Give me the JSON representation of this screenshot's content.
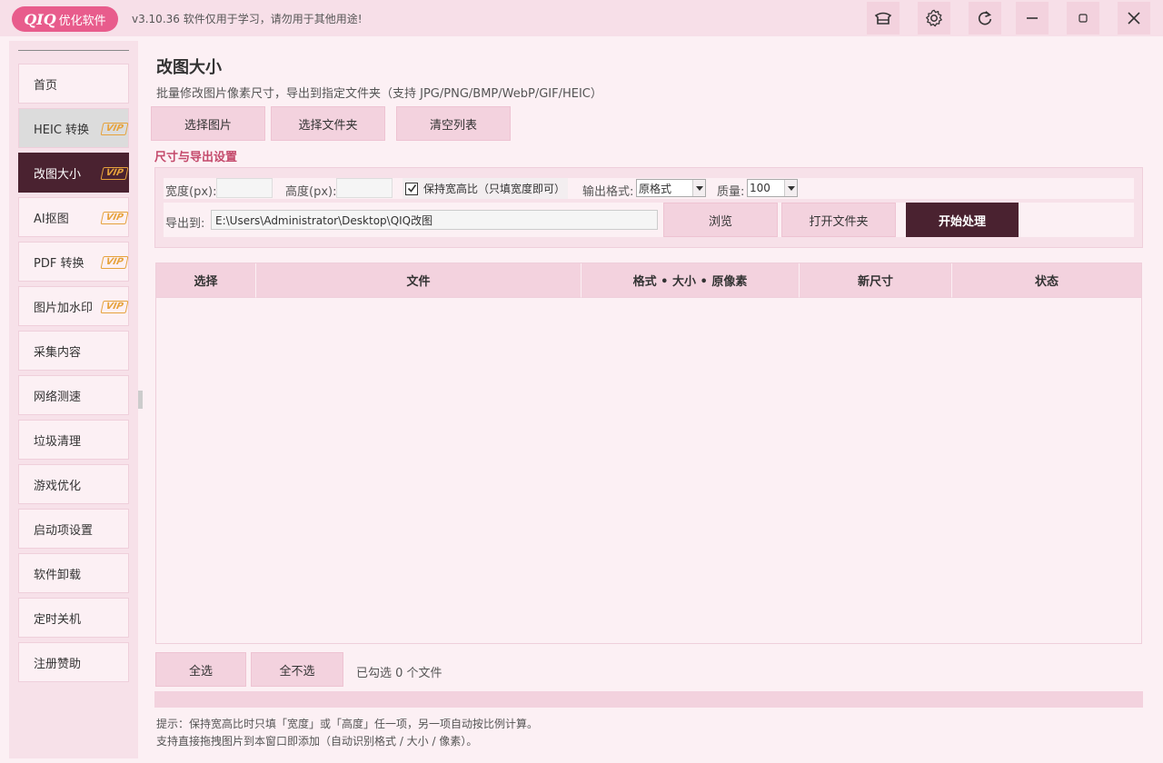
{
  "titlebar": {
    "logo_brand": "QIQ",
    "logo_text": "优化软件",
    "version": "v3.10.36 软件仅用于学习，请勿用于其他用途!",
    "icons": [
      "hat-icon",
      "gear-icon",
      "refresh-icon",
      "minimize-icon",
      "maximize-icon",
      "close-icon"
    ]
  },
  "sidebar": {
    "items": [
      {
        "label": "首页"
      },
      {
        "label": "HEIC 转换",
        "badge": "VIP"
      },
      {
        "label": "改图大小",
        "badge": "VIP"
      },
      {
        "label": "AI抠图",
        "badge": "VIP"
      },
      {
        "label": "PDF 转换",
        "badge": "VIP"
      },
      {
        "label": "图片加水印",
        "badge": "VIP"
      },
      {
        "label": "采集内容"
      },
      {
        "label": "网络测速"
      },
      {
        "label": "垃圾清理"
      },
      {
        "label": "游戏优化"
      },
      {
        "label": "启动项设置"
      },
      {
        "label": "软件卸载"
      },
      {
        "label": "定时关机"
      },
      {
        "label": "注册赞助"
      }
    ],
    "active_item": "改图大小"
  },
  "main": {
    "title": "改图大小",
    "description": "批量修改图片像素尺寸，导出到指定文件夹（支持 JPG/PNG/BMP/WebP/GIF/HEIC）",
    "toolbar": {
      "select_images": "选择图片",
      "select_folder": "选择文件夹",
      "clear_list": "清空列表"
    },
    "settings": {
      "section_title": "尺寸与导出设置",
      "width_label": "宽度(px):",
      "width_value": "",
      "height_label": "高度(px):",
      "height_value": "",
      "keep_ratio_label": "保持宽高比（只填宽度即可）",
      "keep_ratio_checked": true,
      "format_label": "输出格式:",
      "format_value": "原格式",
      "quality_label": "质量:",
      "quality_value": "100",
      "export_label": "导出到:",
      "export_path": "E:\\Users\\Administrator\\Desktop\\QIQ改图",
      "browse": "浏览",
      "open_folder": "打开文件夹",
      "start": "开始处理"
    },
    "table": {
      "columns": [
        "选择",
        "文件",
        "格式 • 大小 • 原像素",
        "新尺寸",
        "状态"
      ],
      "rows": []
    },
    "bottom": {
      "select_all": "全选",
      "select_none": "全不选",
      "selected_count": "已勾选 0 个文件"
    },
    "progress": 0,
    "tips": [
      "提示：保持宽高比时只填「宽度」或「高度」任一项，另一项自动按比例计算。",
      "支持直接拖拽图片到本窗口即添加（自动识别格式 / 大小 / 像素）。"
    ]
  },
  "colors": {
    "accent_dark": "#4a2230",
    "pink_button": "#f3d2de",
    "logo_pink": "#e85c8c",
    "section_title": "#c44a6c",
    "vip_badge": "#e6a23c"
  }
}
